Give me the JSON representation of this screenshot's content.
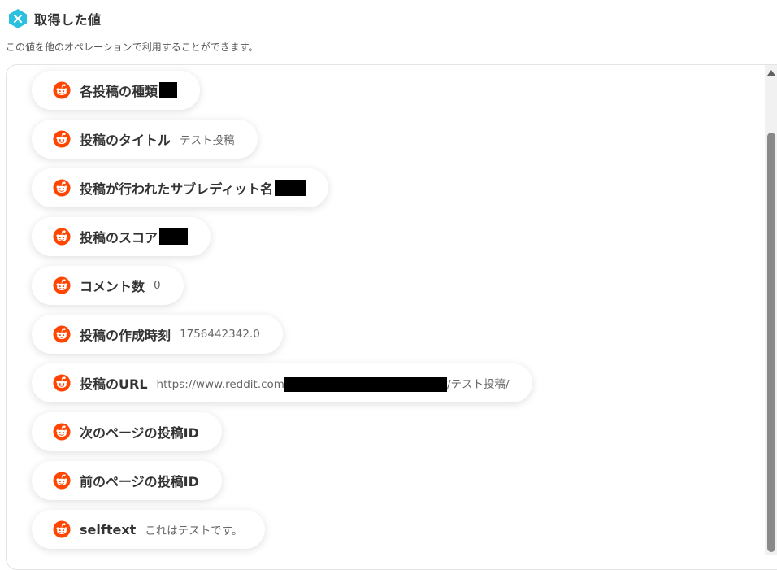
{
  "header": {
    "title": "取得した値",
    "description": "この値を他のオペレーションで利用することができます。",
    "icon": "x-brand-icon"
  },
  "colors": {
    "brand": "#2bbfe0",
    "reddit": "#ff4500"
  },
  "items": [
    {
      "label": "各投稿の種類",
      "value": ""
    },
    {
      "label": "投稿のタイトル",
      "value": "テスト投稿"
    },
    {
      "label": "投稿が行われたサブレディット名",
      "value": ""
    },
    {
      "label": "投稿のスコア",
      "value": ""
    },
    {
      "label": "コメント数",
      "value": "0"
    },
    {
      "label": "投稿の作成時刻",
      "value": "1756442342.0"
    },
    {
      "label": "投稿のURL",
      "value_prefix": "https://www.reddit.com",
      "value_suffix": "/テスト投稿/"
    },
    {
      "label": "次のページの投稿ID",
      "value": ""
    },
    {
      "label": "前のページの投稿ID",
      "value": ""
    },
    {
      "label": "selftext",
      "value": "これはテストです。"
    }
  ]
}
